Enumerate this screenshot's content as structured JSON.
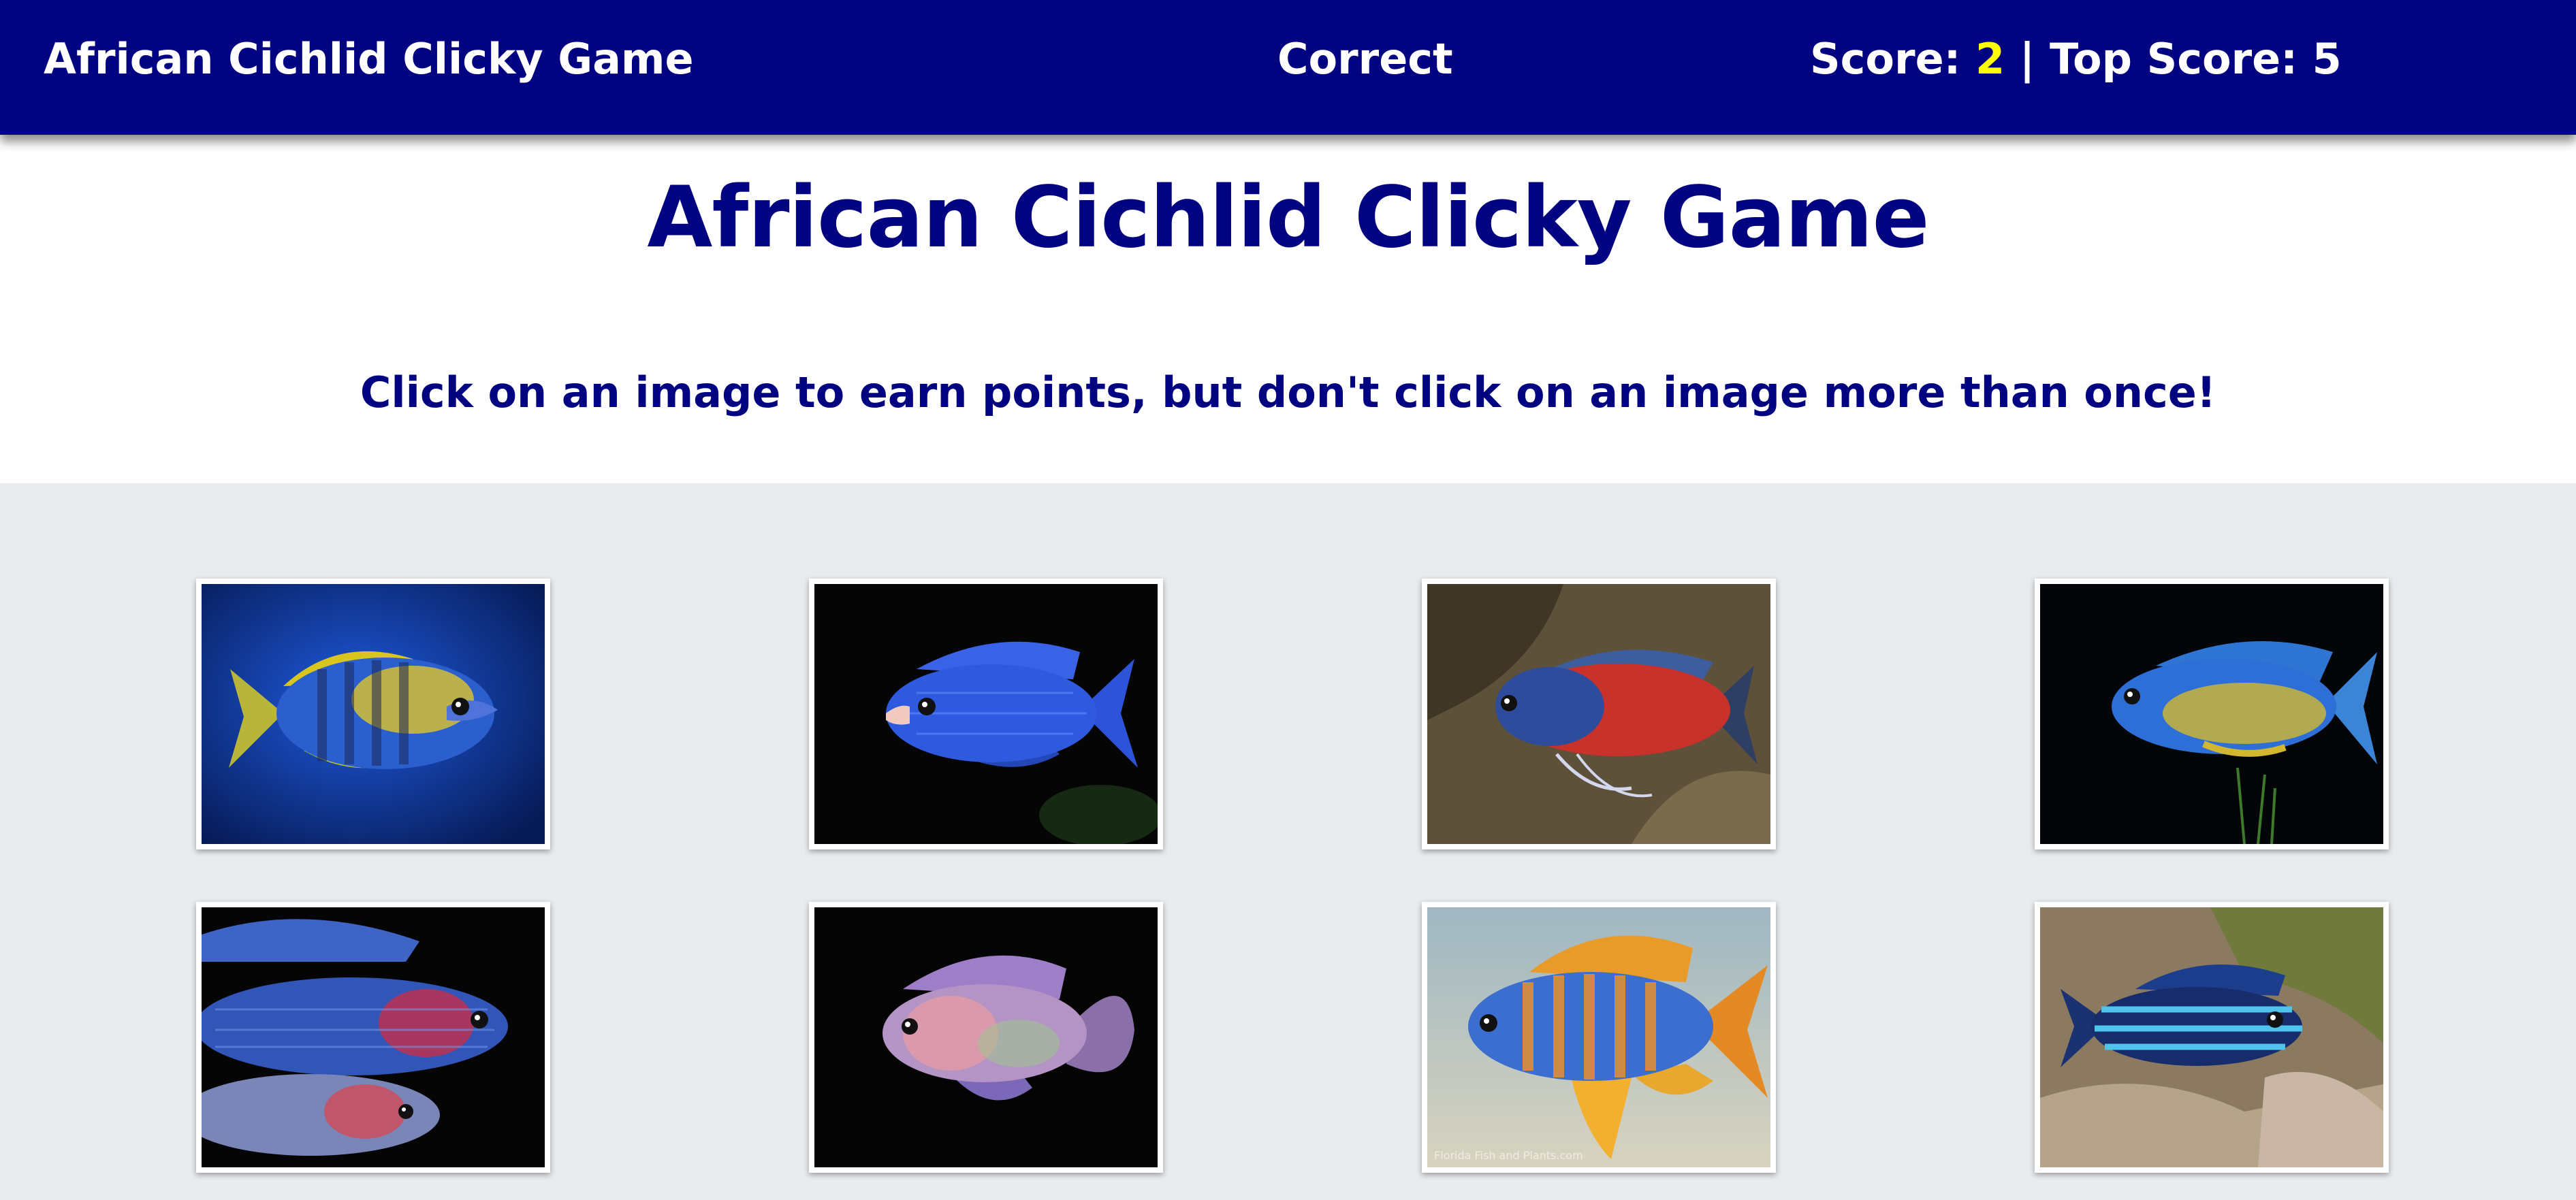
{
  "navbar": {
    "brand": "African Cichlid Clicky Game",
    "status": "Correct",
    "score_label": "Score: ",
    "score_value": "2",
    "separator": " | ",
    "top_score_label": "Top Score: ",
    "top_score_value": "5"
  },
  "header": {
    "title": "African Cichlid Clicky Game",
    "instructions": "Click on an image to earn points, but don't click on an image more than once!"
  },
  "colors": {
    "navbar": "#020381",
    "accent_score": "#ffff00",
    "board_background": "#e9ecef"
  },
  "cards": [
    {
      "name": "blue-yellow-banded-cichlid",
      "watermark": ""
    },
    {
      "name": "electric-blue-cichlid",
      "watermark": ""
    },
    {
      "name": "red-blue-peacock-cichlid",
      "watermark": ""
    },
    {
      "name": "blue-yellow-peacock-cichlid",
      "watermark": ""
    },
    {
      "name": "blue-red-cichlid-pair",
      "watermark": ""
    },
    {
      "name": "pastel-pink-cichlid",
      "watermark": ""
    },
    {
      "name": "orange-blue-peacock-cichlid",
      "watermark": "Florida Fish and Plants.com"
    },
    {
      "name": "striped-blue-mbuna-cichlid",
      "watermark": ""
    }
  ]
}
